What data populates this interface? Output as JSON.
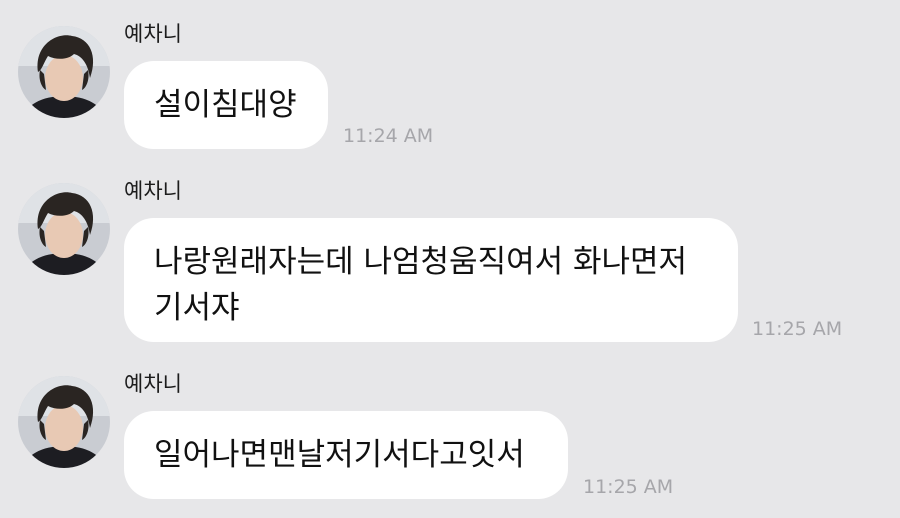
{
  "messages": [
    {
      "sender": "예차니",
      "lines": [
        "설이침대양"
      ],
      "time": "11:24 AM"
    },
    {
      "sender": "예차니",
      "lines": [
        "나랑원래자는데 나엄청움직여서 화나면저",
        "기서쟈"
      ],
      "time": "11:25 AM"
    },
    {
      "sender": "예차니",
      "lines": [
        "일어나면맨날저기서다고잇서"
      ],
      "time": "11:25 AM"
    }
  ],
  "colors": {
    "background": "#e7e7e9",
    "bubble": "#ffffff",
    "timestamp": "#a6a6aa"
  },
  "icons": {
    "avatar": "profile-photo"
  }
}
